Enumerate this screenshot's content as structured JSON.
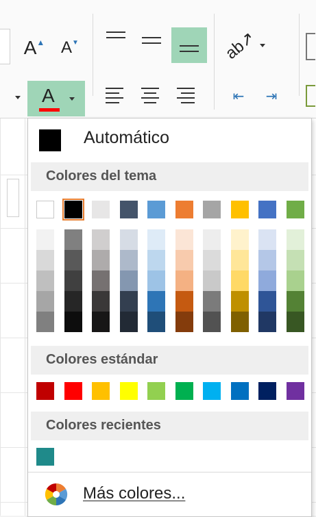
{
  "ribbon": {
    "grow_font_label": "A",
    "shrink_font_label": "A",
    "font_color_label": "A",
    "font_color_underline": "#ff0000"
  },
  "palette": {
    "automatic_label": "Automático",
    "automatic_color": "#000000",
    "theme_title": "Colores del tema",
    "standard_title": "Colores estándar",
    "recent_title": "Colores recientes",
    "more_colors_label": "Más colores...",
    "theme_base": [
      "#ffffff",
      "#000000",
      "#e7e6e6",
      "#44546a",
      "#5b9bd5",
      "#ed7d31",
      "#a5a5a5",
      "#ffc000",
      "#4472c4",
      "#70ad47"
    ],
    "theme_tints": [
      [
        "#f2f2f2",
        "#d9d9d9",
        "#bfbfbf",
        "#a6a6a6",
        "#808080"
      ],
      [
        "#808080",
        "#595959",
        "#404040",
        "#262626",
        "#0d0d0d"
      ],
      [
        "#d0cece",
        "#aeabab",
        "#767171",
        "#3a3838",
        "#171616"
      ],
      [
        "#d6dce5",
        "#adb9ca",
        "#8497b0",
        "#333f50",
        "#222a35"
      ],
      [
        "#deebf7",
        "#bdd7ee",
        "#9dc3e6",
        "#2e75b6",
        "#1f4e79"
      ],
      [
        "#fbe5d6",
        "#f8cbad",
        "#f4b183",
        "#c55a11",
        "#843c0c"
      ],
      [
        "#ededed",
        "#dbdbdb",
        "#c9c9c9",
        "#7b7b7b",
        "#525252"
      ],
      [
        "#fff2cc",
        "#ffe699",
        "#ffd966",
        "#bf9000",
        "#7f6000"
      ],
      [
        "#dae3f3",
        "#b4c7e7",
        "#8faadc",
        "#2f5597",
        "#203864"
      ],
      [
        "#e2f0d9",
        "#c5e0b4",
        "#a9d18e",
        "#548235",
        "#385723"
      ]
    ],
    "standard": [
      "#c00000",
      "#ff0000",
      "#ffc000",
      "#ffff00",
      "#92d050",
      "#00b050",
      "#00b0f0",
      "#0070c0",
      "#002060",
      "#7030a0"
    ],
    "recent": [
      "#1f8a8a"
    ],
    "selected_theme_index": 1
  }
}
